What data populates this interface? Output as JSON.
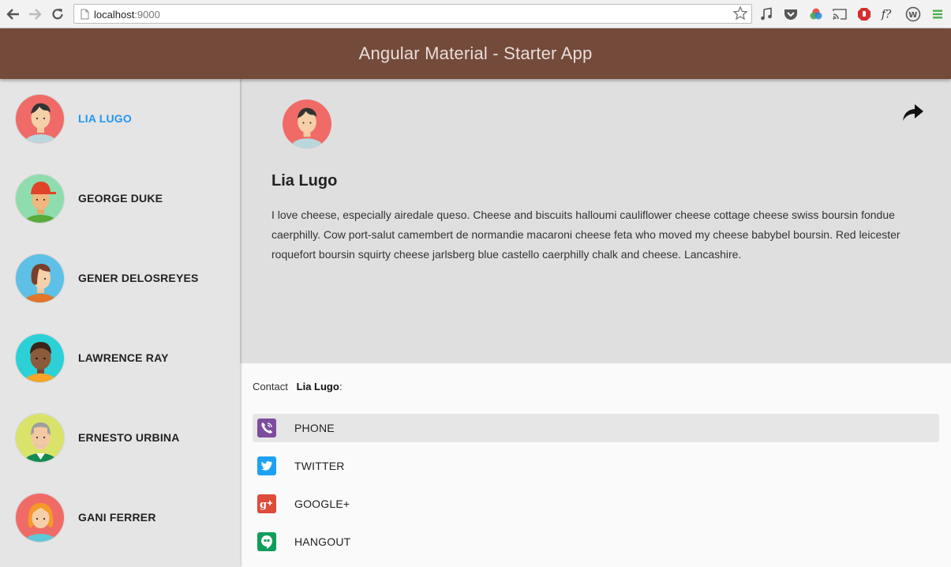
{
  "browser": {
    "url_host": "localhost",
    "url_port": ":9000"
  },
  "toolbar": {
    "title": "Angular Material - Starter App"
  },
  "sidebar": {
    "users": [
      {
        "name": "LIA LUGO",
        "avatar": "avatar-lia-icon",
        "selected": true
      },
      {
        "name": "GEORGE DUKE",
        "avatar": "avatar-george-icon"
      },
      {
        "name": "GENER DELOSREYES",
        "avatar": "avatar-gener-icon"
      },
      {
        "name": "LAWRENCE RAY",
        "avatar": "avatar-lawrence-icon"
      },
      {
        "name": "ERNESTO URBINA",
        "avatar": "avatar-ernesto-icon"
      },
      {
        "name": "GANI FERRER",
        "avatar": "avatar-gani-icon"
      }
    ]
  },
  "content": {
    "name": "Lia Lugo",
    "bio": "I love cheese, especially airedale queso. Cheese and biscuits halloumi cauliflower cheese cottage cheese swiss boursin fondue caerphilly. Cow port-salut camembert de normandie macaroni cheese feta who moved my cheese babybel boursin. Red leicester roquefort boursin squirty cheese jarlsberg blue castello caerphilly chalk and cheese. Lancashire."
  },
  "sheet": {
    "contact_label": "Contact",
    "contact_name": "Lia Lugo",
    "contact_suffix": ":",
    "items": [
      {
        "label": "PHONE",
        "icon": "phone-icon",
        "color": "#7d4c9e"
      },
      {
        "label": "TWITTER",
        "icon": "twitter-icon",
        "color": "#1da1f2"
      },
      {
        "label": "GOOGLE+",
        "icon": "google-plus-icon",
        "color": "#dd4b39"
      },
      {
        "label": "HANGOUT",
        "icon": "hangout-icon",
        "color": "#0f9d58"
      }
    ]
  },
  "colors": {
    "toolbar": "#744a3b",
    "selected_user": "#2196f3"
  }
}
